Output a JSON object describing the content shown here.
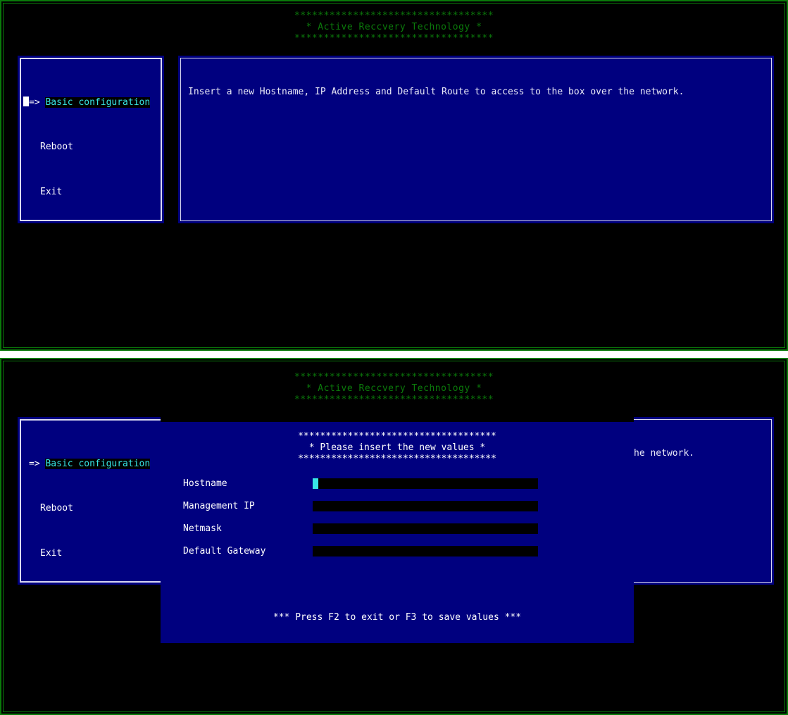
{
  "banner": {
    "rule": "**********************************",
    "title": "* Active Reccvery Technology *"
  },
  "menu": {
    "arrow": "=>",
    "items": [
      {
        "label": "Basic configuration",
        "selected": true
      },
      {
        "label": "Reboot",
        "selected": false
      },
      {
        "label": "Exit",
        "selected": false
      }
    ]
  },
  "info_panel": {
    "text": "Insert a new Hostname, IP Address and Default Route to access to the box over the network."
  },
  "bottom_screen": {
    "info_tail": "he network."
  },
  "dialog": {
    "rule": "************************************",
    "title": "* Please insert the new values *",
    "fields": [
      {
        "label": "Hostname",
        "value": "",
        "caret": true
      },
      {
        "label": "Management IP",
        "value": "",
        "caret": false
      },
      {
        "label": "Netmask",
        "value": "",
        "caret": false
      },
      {
        "label": "Default Gateway",
        "value": "",
        "caret": false
      }
    ],
    "footer": "*** Press F2 to exit or F3 to save values ***"
  },
  "colors": {
    "screen_border": "#0a7a0a",
    "banner_green": "#0b7a0b",
    "panel_blue": "#00007f",
    "panel_frame": "#d8d8f0",
    "highlight_cyan": "#37e6e6",
    "text_white": "#ffffff",
    "field_black": "#000000"
  }
}
